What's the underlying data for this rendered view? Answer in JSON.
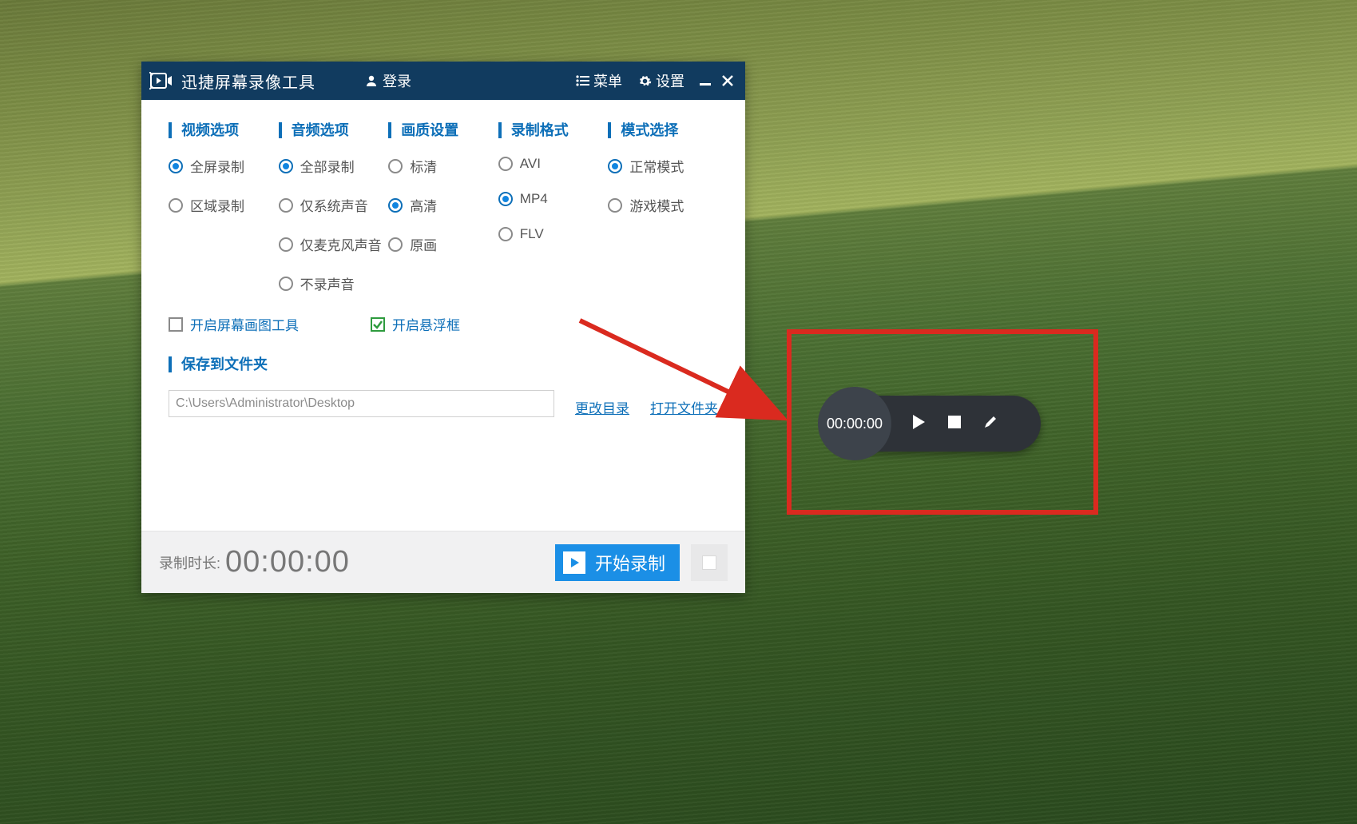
{
  "titlebar": {
    "app_title": "迅捷屏幕录像工具",
    "login": "登录",
    "menu": "菜单",
    "settings": "设置"
  },
  "columns": {
    "video": {
      "header": "视频选项",
      "opts": [
        "全屏录制",
        "区域录制"
      ],
      "selected": 0
    },
    "audio": {
      "header": "音频选项",
      "opts": [
        "全部录制",
        "仅系统声音",
        "仅麦克风声音",
        "不录声音"
      ],
      "selected": 0
    },
    "quality": {
      "header": "画质设置",
      "opts": [
        "标清",
        "高清",
        "原画"
      ],
      "selected": 1
    },
    "format": {
      "header": "录制格式",
      "opts": [
        "AVI",
        "MP4",
        "FLV"
      ],
      "selected": 1
    },
    "mode": {
      "header": "模式选择",
      "opts": [
        "正常模式",
        "游戏模式"
      ],
      "selected": 0
    }
  },
  "checks": {
    "draw_tool": {
      "label": "开启屏幕画图工具",
      "checked": false
    },
    "float_box": {
      "label": "开启悬浮框",
      "checked": true
    }
  },
  "save": {
    "header": "保存到文件夹",
    "path": "C:\\Users\\Administrator\\Desktop",
    "change_dir": "更改目录",
    "open_dir": "打开文件夹"
  },
  "footer": {
    "dur_label": "录制时长:",
    "dur_time": "00:00:00",
    "start_label": "开始录制"
  },
  "float": {
    "time": "00:00:00"
  },
  "colors": {
    "accent": "#0d6fb8",
    "titlebar": "#113b5f",
    "start_btn": "#1b8fe6",
    "callout": "#da2a1f"
  }
}
